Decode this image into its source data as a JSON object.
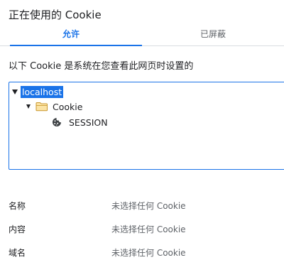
{
  "dialog": {
    "title": "正在使用的 Cookie",
    "tabs": [
      {
        "label": "允许",
        "active": true
      },
      {
        "label": "已屏蔽",
        "active": false
      }
    ],
    "description": "以下 Cookie 是系统在您查看此网页时设置的"
  },
  "tree": {
    "root": {
      "label": "localhost",
      "expanded": true,
      "selected": true,
      "children": [
        {
          "label": "Cookie",
          "icon": "folder-icon",
          "expanded": true,
          "children": [
            {
              "label": "SESSION",
              "icon": "cookie-icon"
            }
          ]
        }
      ]
    }
  },
  "details": [
    {
      "label": "名称",
      "value": "未选择任何 Cookie"
    },
    {
      "label": "内容",
      "value": "未选择任何 Cookie"
    },
    {
      "label": "域名",
      "value": "未选择任何 Cookie"
    }
  ],
  "colors": {
    "accent": "#1a73e8",
    "muted_text": "#5f6368",
    "folder": "#f0c36d"
  }
}
